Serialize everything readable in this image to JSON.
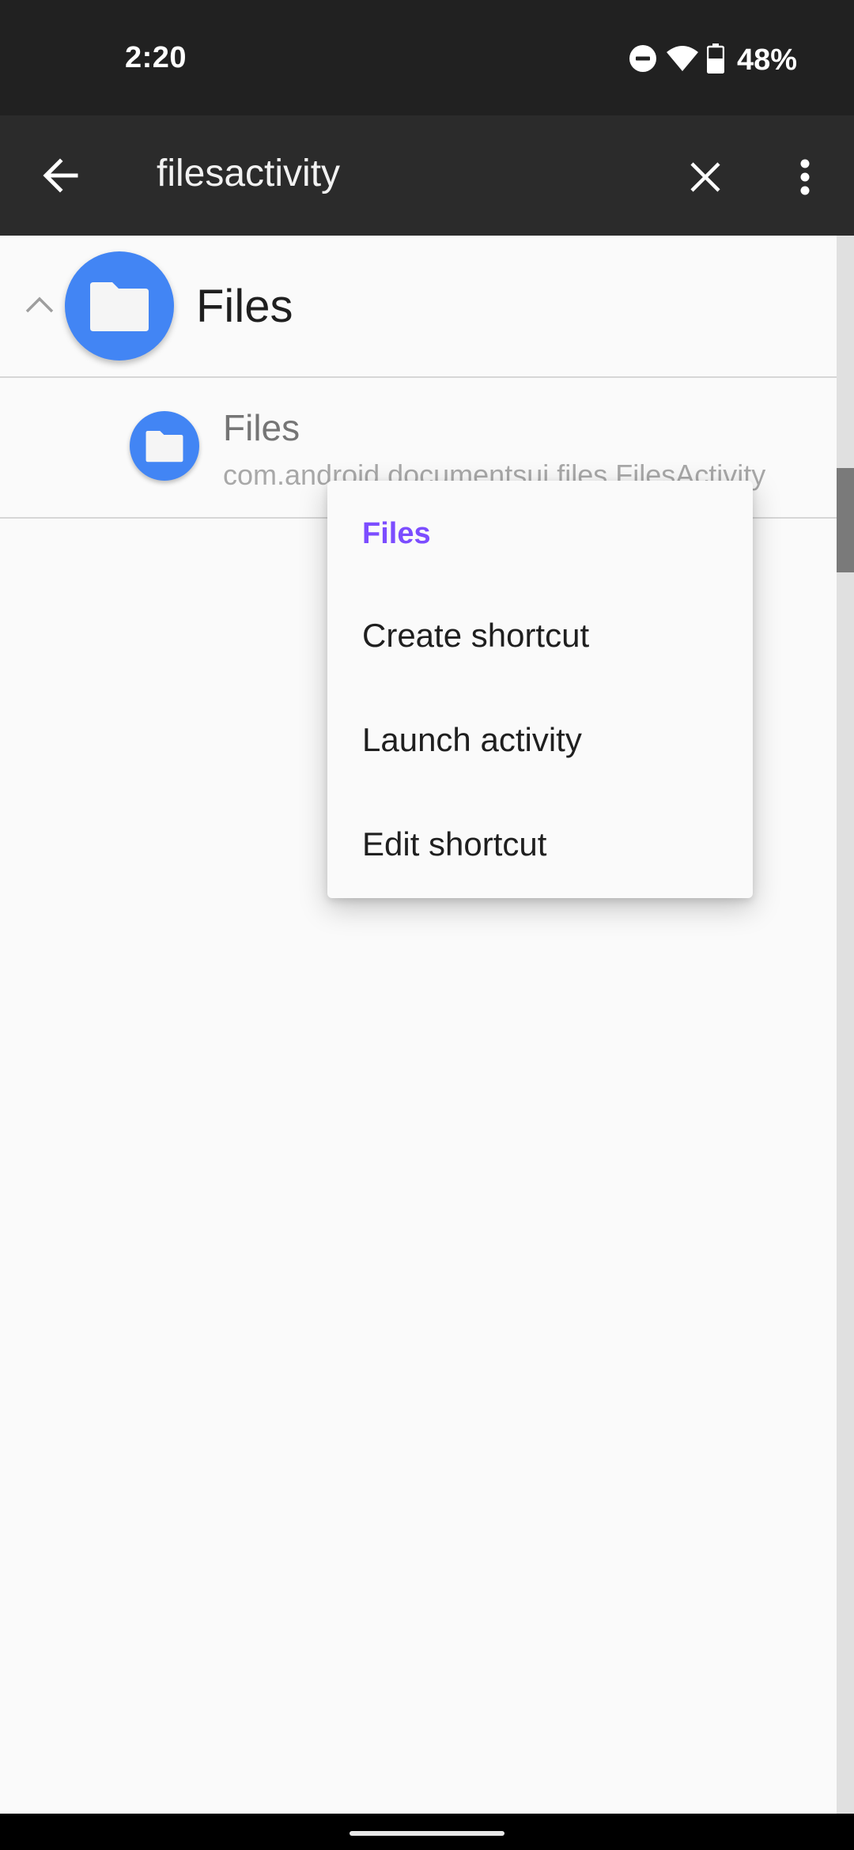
{
  "status_bar": {
    "time": "2:20",
    "battery": "48%",
    "icons": [
      "do-not-disturb-icon",
      "wifi-icon",
      "battery-icon"
    ]
  },
  "toolbar": {
    "query": "filesactivity",
    "icons": [
      "back-arrow-icon",
      "clear-icon",
      "overflow-menu-icon"
    ]
  },
  "list": {
    "group": {
      "title": "Files",
      "expanded": true,
      "icon": "folder-icon",
      "icon_color": "#4285F4"
    },
    "activity": {
      "title": "Files",
      "subtitle": "com.android.documentsui.files.FilesActivity",
      "icon": "folder-icon"
    }
  },
  "popup_menu": {
    "header": "Files",
    "header_color": "#7C4DFF",
    "items": [
      {
        "label": "Create shortcut"
      },
      {
        "label": "Launch activity"
      },
      {
        "label": "Edit shortcut"
      }
    ]
  }
}
